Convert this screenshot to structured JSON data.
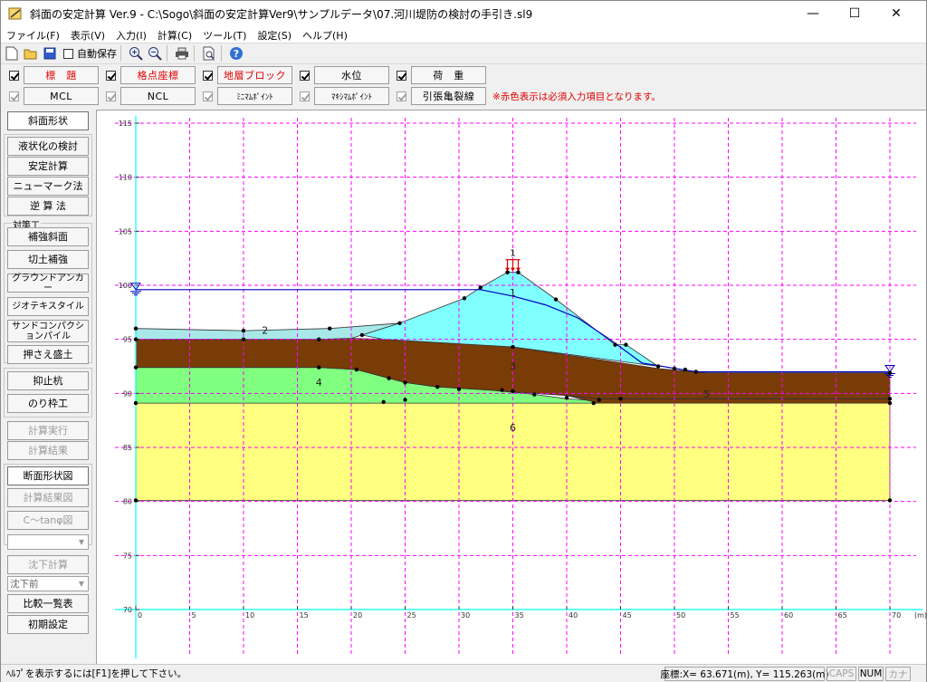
{
  "window": {
    "title": "斜面の安定計算 Ver.9 - C:\\Sogo\\斜面の安定計算Ver9\\サンプルデータ\\07.河川堤防の検討の手引き.sl9",
    "minimize_glyph": "—",
    "maximize_glyph": "☐",
    "close_glyph": "✕"
  },
  "menu": [
    "ファイル(F)",
    "表示(V)",
    "入力(I)",
    "計算(C)",
    "ツール(T)",
    "設定(S)",
    "ヘルプ(H)"
  ],
  "toolbar": {
    "icons": [
      "new-file-icon",
      "open-folder-icon",
      "save-icon",
      "zoom-in-icon",
      "zoom-out-icon",
      "print-icon",
      "print-preview-icon",
      "help-icon"
    ],
    "autosave_label": "自動保存",
    "autosave_checked": false
  },
  "conditions": {
    "row1": [
      {
        "label": "標　題",
        "checked": true,
        "required": true
      },
      {
        "label": "格点座標",
        "checked": true,
        "required": true
      },
      {
        "label": "地層ブロック",
        "checked": true,
        "required": true
      },
      {
        "label": "水位",
        "checked": true,
        "required": false
      },
      {
        "label": "荷　重",
        "checked": true,
        "required": false
      }
    ],
    "row2": [
      {
        "label": "MCL",
        "checked": true,
        "disabled": true
      },
      {
        "label": "NCL",
        "checked": true,
        "disabled": true
      },
      {
        "label": "ﾐﾆﾏﾑﾎﾟｲﾝﾄ",
        "checked": true,
        "disabled": true
      },
      {
        "label": "ﾏｷｼﾏﾑﾎﾟｲﾝﾄ",
        "checked": true,
        "disabled": true
      },
      {
        "label": "引張亀裂線",
        "checked": true,
        "disabled": true
      }
    ],
    "notice": "※赤色表示は必須入力項目となります。"
  },
  "left": {
    "tab_top": "斜面形状",
    "group1": [
      "液状化の検討",
      "安定計算",
      "ニューマーク法",
      "逆 算 法"
    ],
    "group2_label": "対策工",
    "group2": [
      "補強斜面",
      "切土補強",
      "グラウンドアンカー",
      "ジオテキスタイル",
      "サンドコンパクションパイル",
      "押さえ盛土"
    ],
    "group3": [
      "抑止杭",
      "のり枠工"
    ],
    "calc_run": "計算実行",
    "calc_result": "計算結果",
    "view_tabs": [
      "断面形状図",
      "計算結果図",
      "C～tanφ図"
    ],
    "dropdown1_value": "",
    "settlement": "沈下計算",
    "dropdown2_value": "沈下前",
    "compare": "比較一覧表",
    "initial": "初期設定"
  },
  "status": {
    "help": "ﾍﾙﾌﾟを表示するには[F1]を押して下さい。",
    "coord": "座標:X=  63.671(m), Y= 115.263(m)",
    "caps": "CAPS",
    "num": "NUM",
    "kana": "カナ"
  },
  "chart_data": {
    "type": "diagram",
    "x_range": [
      0,
      70
    ],
    "y_range": [
      70,
      115
    ],
    "x_unit": "(m)",
    "x_ticks": [
      0,
      5,
      10,
      15,
      20,
      25,
      30,
      35,
      40,
      45,
      50,
      55,
      60,
      65,
      70
    ],
    "y_ticks": [
      70,
      75,
      80,
      85,
      90,
      95,
      100,
      105,
      110,
      115
    ],
    "grid": true,
    "colors": {
      "layer1": "#80ffff",
      "layer2": "#a8e8e8",
      "layer3": "#7a3c06",
      "layer4": "#80ff80",
      "layer5": "#7a3c06",
      "layer6": "#ffff80",
      "grid": "#ff00ff",
      "axis": "#00ffff",
      "water": "#0000c0"
    },
    "layers": [
      {
        "label": "6",
        "label_at": [
          35,
          86.5
        ],
        "points": [
          [
            0,
            89.1
          ],
          [
            70,
            89.1
          ],
          [
            70,
            80.1
          ],
          [
            0,
            80.1
          ]
        ]
      },
      {
        "label": "4",
        "label_at": [
          17,
          90.7
        ],
        "points": [
          [
            0,
            92.4
          ],
          [
            17,
            92.4
          ],
          [
            20.5,
            92.2
          ],
          [
            23.5,
            91.4
          ],
          [
            25,
            91.0
          ],
          [
            28,
            90.6
          ],
          [
            33,
            90.3
          ],
          [
            37,
            89.9
          ],
          [
            40,
            89.5
          ],
          [
            43,
            89.3
          ],
          [
            43,
            89.1
          ],
          [
            0,
            89.1
          ]
        ]
      },
      {
        "label": "5",
        "label_at": [
          53,
          89.6
        ],
        "points": [
          [
            40,
            89.8
          ],
          [
            43,
            89.5
          ],
          [
            50,
            89.5
          ],
          [
            70,
            89.5
          ],
          [
            70,
            89.1
          ],
          [
            43,
            89.1
          ]
        ]
      },
      {
        "label": "3",
        "label_at": [
          35,
          92.2
        ],
        "points": [
          [
            0,
            95.0
          ],
          [
            17,
            95.0
          ],
          [
            20,
            95.1
          ],
          [
            23,
            95.0
          ],
          [
            35,
            94.3
          ],
          [
            48.5,
            92.3
          ],
          [
            53,
            91.9
          ],
          [
            70,
            91.9
          ],
          [
            70,
            89.5
          ],
          [
            50,
            89.5
          ],
          [
            43,
            89.5
          ],
          [
            40,
            89.8
          ],
          [
            37,
            90.0
          ],
          [
            33,
            90.3
          ],
          [
            28,
            90.6
          ],
          [
            25,
            91.0
          ],
          [
            23.5,
            91.4
          ],
          [
            20.5,
            92.2
          ],
          [
            17,
            92.4
          ],
          [
            0,
            92.4
          ]
        ]
      },
      {
        "label": "1",
        "label_at": [
          35,
          99.0
        ],
        "points": [
          [
            24.5,
            96.5
          ],
          [
            30.5,
            98.8
          ],
          [
            32,
            99.8
          ],
          [
            34.5,
            101.2
          ],
          [
            35.5,
            101.2
          ],
          [
            39,
            98.7
          ],
          [
            44.5,
            94.5
          ],
          [
            45.5,
            94.5
          ],
          [
            48.5,
            92.5
          ],
          [
            35,
            94.3
          ],
          [
            23,
            95.0
          ],
          [
            21,
            95.4
          ]
        ]
      },
      {
        "label": "2",
        "label_at": [
          12,
          95.5
        ],
        "points": [
          [
            0,
            96.0
          ],
          [
            10,
            95.8
          ],
          [
            18,
            96.0
          ],
          [
            24.5,
            96.5
          ],
          [
            21,
            95.4
          ],
          [
            20,
            95.1
          ],
          [
            17,
            95.0
          ],
          [
            0,
            95.0
          ]
        ]
      }
    ],
    "phreatic_line": [
      [
        0,
        99.6
      ],
      [
        32,
        99.6
      ],
      [
        35,
        99.0
      ],
      [
        38,
        98.2
      ],
      [
        41,
        97.0
      ],
      [
        44,
        95.0
      ],
      [
        47,
        92.8
      ],
      [
        52,
        92.0
      ],
      [
        70,
        92.0
      ]
    ],
    "water_marks": [
      [
        0,
        99.6
      ],
      [
        70,
        92.0
      ]
    ],
    "load": {
      "label": "1",
      "at": [
        35,
        101.2
      ]
    },
    "nodes": [
      [
        0,
        96.0
      ],
      [
        10,
        95.8
      ],
      [
        18,
        96.0
      ],
      [
        21,
        95.4
      ],
      [
        24.5,
        96.5
      ],
      [
        30.5,
        98.8
      ],
      [
        32,
        99.8
      ],
      [
        34.5,
        101.2
      ],
      [
        35.5,
        101.2
      ],
      [
        39,
        98.7
      ],
      [
        44.5,
        94.5
      ],
      [
        45.5,
        94.5
      ],
      [
        48.5,
        92.5
      ],
      [
        50,
        92.3
      ],
      [
        51,
        92.2
      ],
      [
        52,
        92.0
      ],
      [
        0,
        95.0
      ],
      [
        10,
        95.0
      ],
      [
        17,
        95.0
      ],
      [
        35,
        94.3
      ],
      [
        0,
        92.4
      ],
      [
        17,
        92.4
      ],
      [
        20.5,
        92.2
      ],
      [
        23.5,
        91.4
      ],
      [
        25,
        91.0
      ],
      [
        28,
        90.6
      ],
      [
        30,
        90.4
      ],
      [
        34,
        90.3
      ],
      [
        37,
        89.9
      ],
      [
        40,
        89.6
      ],
      [
        43,
        89.4
      ],
      [
        45,
        89.5
      ],
      [
        0,
        89.1
      ],
      [
        23,
        89.2
      ],
      [
        25,
        89.4
      ],
      [
        35,
        90.2
      ],
      [
        42.5,
        89.1
      ],
      [
        70,
        89.5
      ],
      [
        70,
        91.9
      ],
      [
        70,
        89.1
      ],
      [
        0,
        80.1
      ],
      [
        70,
        80.1
      ]
    ]
  }
}
